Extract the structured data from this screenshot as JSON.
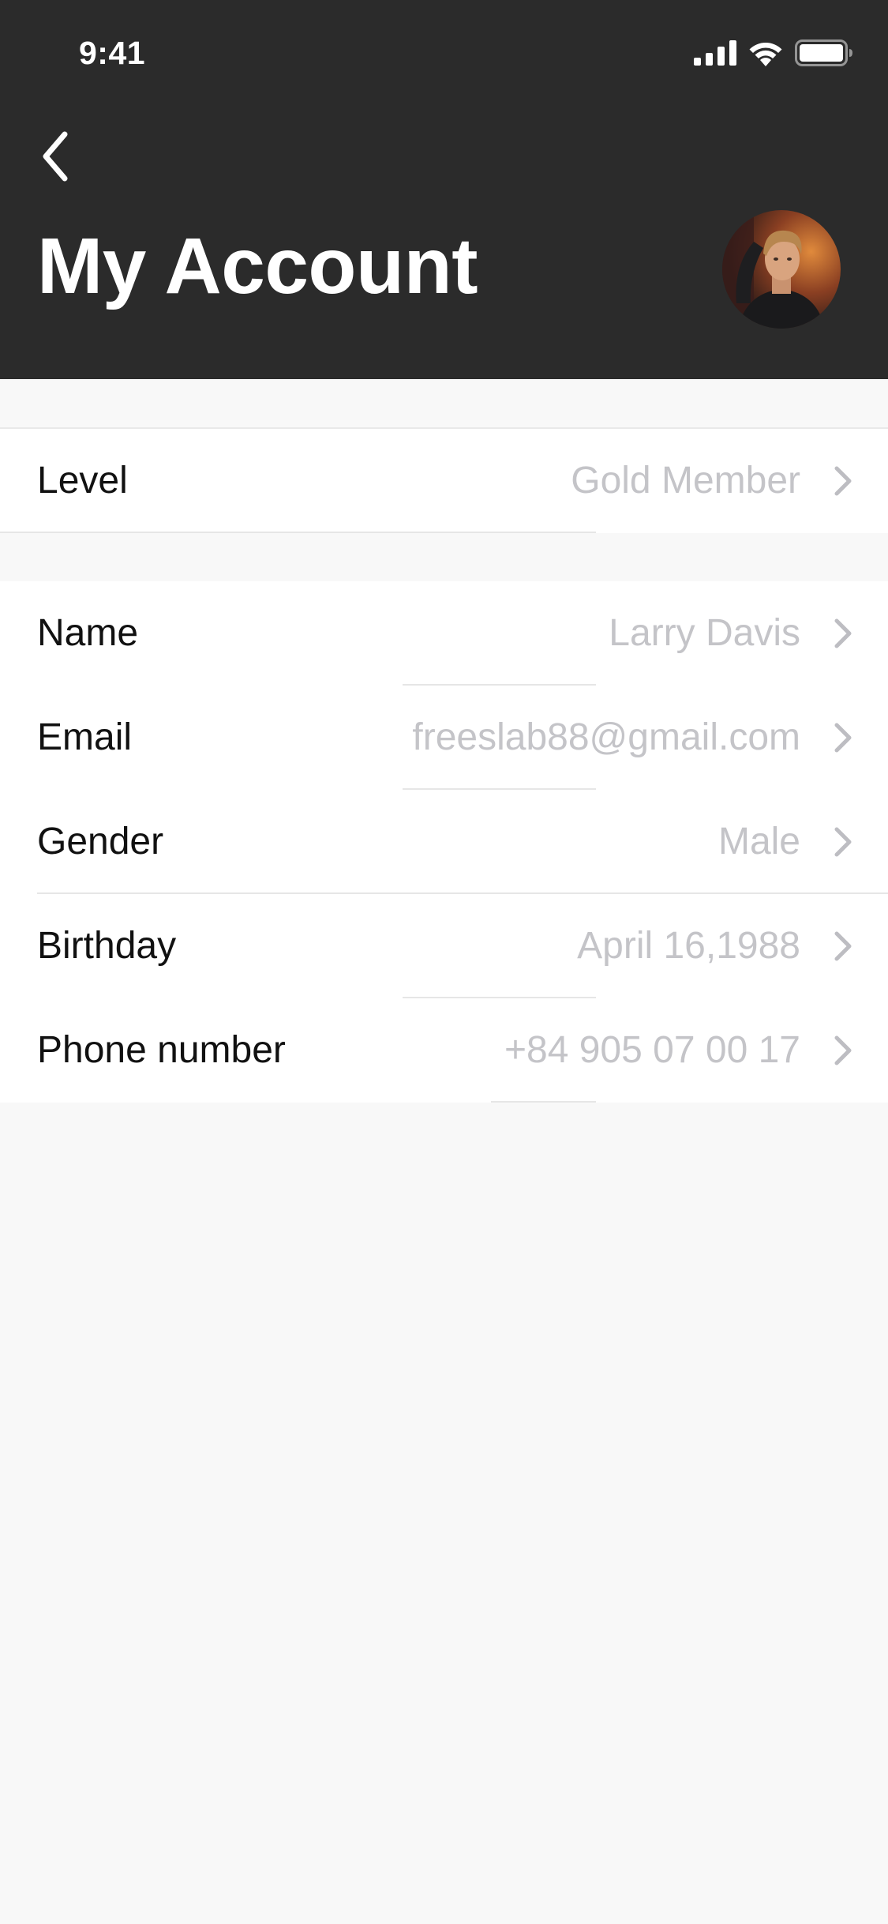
{
  "status_bar": {
    "time": "9:41",
    "icons": [
      "cellular-signal-icon",
      "wifi-icon",
      "battery-icon"
    ]
  },
  "header": {
    "back_icon": "chevron-left-icon",
    "title": "My Account"
  },
  "avatar": {
    "description_icon": "user-avatar-photo"
  },
  "groups": {
    "level": {
      "rows": [
        {
          "label": "Level",
          "value": "Gold Member"
        }
      ]
    },
    "profile": {
      "rows": [
        {
          "label": "Name",
          "value": "Larry Davis"
        },
        {
          "label": "Email",
          "value": "freeslab88@gmail.com"
        },
        {
          "label": "Gender",
          "value": "Male"
        },
        {
          "label": "Birthday",
          "value": "April 16,1988"
        },
        {
          "label": "Phone number",
          "value": "+84 905 07 00 17"
        }
      ]
    }
  },
  "colors": {
    "header_bg": "#2b2b2b",
    "page_bg": "#f8f8f8",
    "row_bg": "#ffffff",
    "label_text": "#111111",
    "value_text": "#c4c4c8",
    "chevron": "#bdbdc2"
  }
}
